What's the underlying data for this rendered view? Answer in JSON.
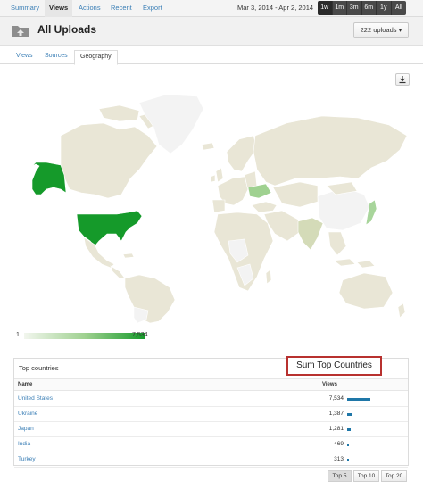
{
  "nav": {
    "items": [
      "Summary",
      "Views",
      "Actions",
      "Recent",
      "Export"
    ],
    "active": "Views",
    "date_range": "Mar 3, 2014 - Apr 2, 2014",
    "ranges": [
      "1w",
      "1m",
      "3m",
      "6m",
      "1y",
      "All"
    ]
  },
  "header": {
    "title": "All Uploads",
    "uploads_button": "222 uploads ▾"
  },
  "tabs": [
    "Views",
    "Sources",
    "Geography"
  ],
  "legend": {
    "min": "1",
    "max": "7,534"
  },
  "colors": {
    "high": "#159a2a",
    "mid": "#9fd190",
    "low": "#e9e6d6",
    "nodata": "#f3f3f3",
    "bar": "#1f77a8",
    "annotation": "#b8312f"
  },
  "table": {
    "caption": "Top countries",
    "col_name": "Name",
    "col_views": "Views",
    "rows": [
      {
        "country": "United States",
        "views": "7,534",
        "share": 1.0
      },
      {
        "country": "Ukraine",
        "views": "1,387",
        "share": 0.184
      },
      {
        "country": "Japan",
        "views": "1,281",
        "share": 0.17
      },
      {
        "country": "India",
        "views": "469",
        "share": 0.062
      },
      {
        "country": "Turkey",
        "views": "313",
        "share": 0.042
      }
    ]
  },
  "annotation": "Sum Top Countries",
  "pager": [
    "Top 5",
    "Top 10",
    "Top 20"
  ],
  "pager_active": "Top 5"
}
